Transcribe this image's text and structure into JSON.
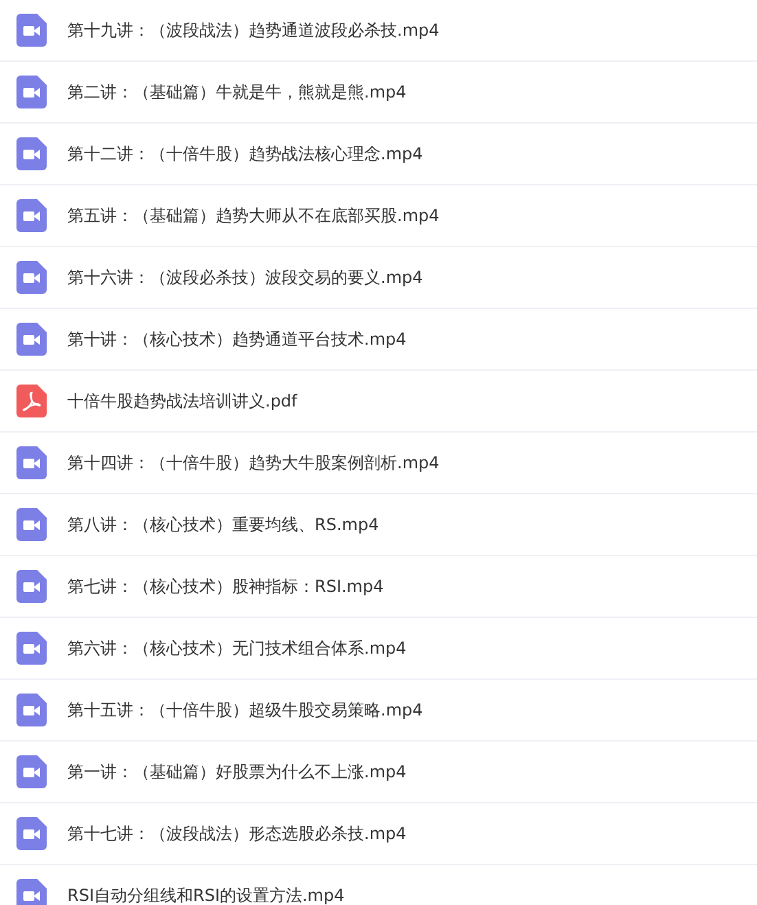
{
  "files": [
    {
      "kind": "video",
      "name": "第十九讲：（波段战法）趋势通道波段必杀技.mp4"
    },
    {
      "kind": "video",
      "name": "第二讲：（基础篇）牛就是牛，熊就是熊.mp4"
    },
    {
      "kind": "video",
      "name": "第十二讲：（十倍牛股）趋势战法核心理念.mp4"
    },
    {
      "kind": "video",
      "name": "第五讲：（基础篇）趋势大师从不在底部买股.mp4"
    },
    {
      "kind": "video",
      "name": "第十六讲：（波段必杀技）波段交易的要义.mp4"
    },
    {
      "kind": "video",
      "name": "第十讲：（核心技术）趋势通道平台技术.mp4"
    },
    {
      "kind": "pdf",
      "name": "十倍牛股趋势战法培训讲义.pdf"
    },
    {
      "kind": "video",
      "name": "第十四讲：（十倍牛股）趋势大牛股案例剖析.mp4"
    },
    {
      "kind": "video",
      "name": "第八讲：（核心技术）重要均线、RS.mp4"
    },
    {
      "kind": "video",
      "name": "第七讲：（核心技术）股神指标：RSI.mp4"
    },
    {
      "kind": "video",
      "name": "第六讲：（核心技术）无门技术组合体系.mp4"
    },
    {
      "kind": "video",
      "name": "第十五讲：（十倍牛股）超级牛股交易策略.mp4"
    },
    {
      "kind": "video",
      "name": "第一讲：（基础篇）好股票为什么不上涨.mp4"
    },
    {
      "kind": "video",
      "name": "第十七讲：（波段战法）形态选股必杀技.mp4"
    },
    {
      "kind": "video",
      "name": "RSI自动分组线和RSI的设置方法.mp4"
    }
  ]
}
